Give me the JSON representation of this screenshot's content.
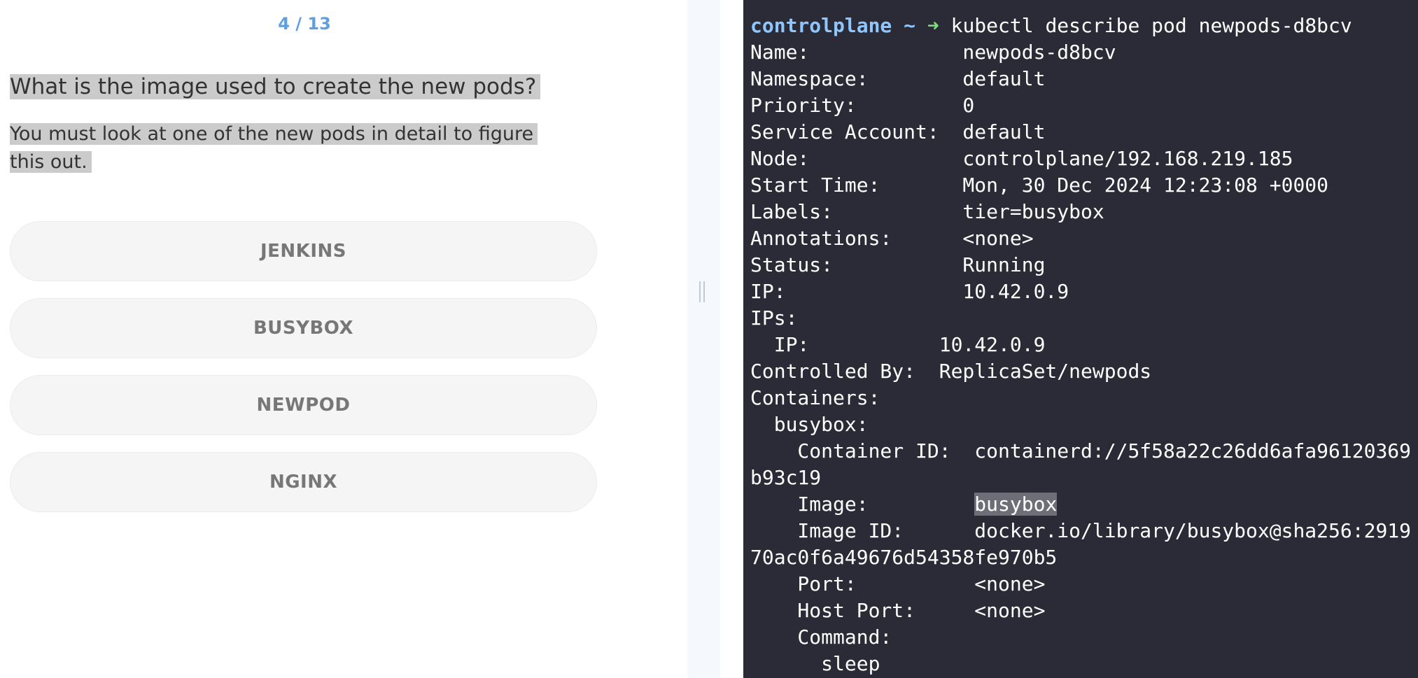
{
  "quiz": {
    "progress": "4 / 13",
    "question": "What is the image used to create the new pods?",
    "hint": "You must look at one of the new pods in detail to figure this out.",
    "options": [
      "JENKINS",
      "BUSYBOX",
      "NEWPOD",
      "NGINX"
    ]
  },
  "terminal": {
    "prompt": "controlplane ~",
    "prompt_arrow": "➜",
    "command": "kubectl describe pod newpods-d8bcv",
    "lines": [
      "Name:             newpods-d8bcv",
      "Namespace:        default",
      "Priority:         0",
      "Service Account:  default",
      "Node:             controlplane/192.168.219.185",
      "Start Time:       Mon, 30 Dec 2024 12:23:08 +0000",
      "Labels:           tier=busybox",
      "Annotations:      <none>",
      "Status:           Running",
      "IP:               10.42.0.9",
      "IPs:",
      "  IP:           10.42.0.9",
      "Controlled By:  ReplicaSet/newpods",
      "Containers:",
      "  busybox:",
      "    Container ID:  containerd://5f58a22c26dd6afa96120369",
      "b93c19"
    ],
    "image_label": "    Image:         ",
    "image_value": "busybox",
    "lines_after": [
      "    Image ID:      docker.io/library/busybox@sha256:2919",
      "70ac0f6a49676d54358fe970b5",
      "    Port:          <none>",
      "    Host Port:     <none>",
      "    Command:",
      "      sleep"
    ]
  },
  "colors": {
    "progress": "#5e9fe0",
    "terminal_bg": "#2b2b38",
    "prompt": "#8ec7ff",
    "arrow": "#7ee07e",
    "highlight": "#cbcbcb"
  }
}
